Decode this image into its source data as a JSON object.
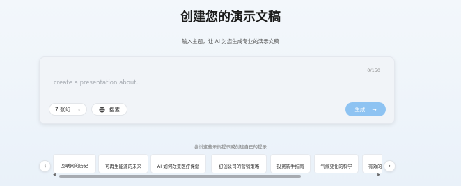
{
  "header": {
    "title": "创建您的演示文稿",
    "subtitle": "输入主题，让 AI 为您生成专业的演示文稿"
  },
  "composer": {
    "char_count": "0/150",
    "prompt_value": "",
    "prompt_placeholder": "create a presentation about..",
    "slides_select": {
      "label": "7 张幻...",
      "icon": "chevron-down-icon"
    },
    "search_button": {
      "label": "搜索",
      "icon": "globe-icon"
    },
    "generate_button": {
      "label": "生成",
      "icon": "arrow-right-icon",
      "color": "#8ec3f2"
    }
  },
  "examples": {
    "hint": "尝试这些示例提示或创建自己的提示",
    "items": [
      "互联网的历史",
      "可再生能源的未来",
      "AI 如何改变医疗保健",
      "初创公司的营销策略",
      "投资新手指南",
      "气候变化的科学",
      "有效的"
    ],
    "prev_icon": "chevron-left-icon",
    "next_icon": "chevron-right-icon"
  }
}
